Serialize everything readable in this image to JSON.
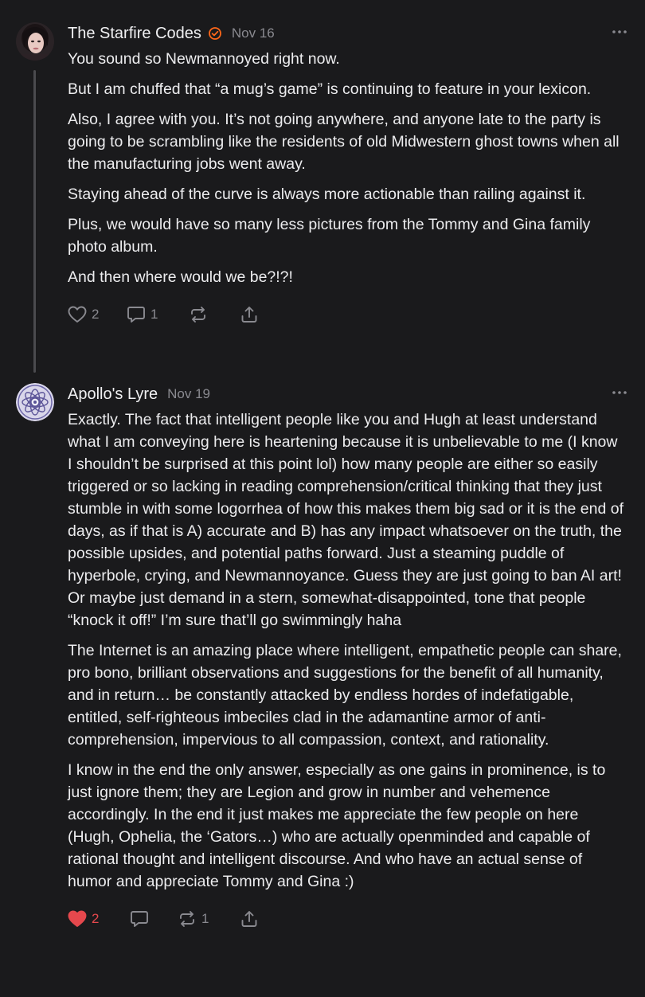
{
  "comments": [
    {
      "author": "The Starfire Codes",
      "verified_icon": "verified-check-icon",
      "date": "Nov 16",
      "paragraphs": [
        "You sound so Newmannoyed right now.",
        "But I am chuffed that “a mug’s game” is continuing to feature in your lexicon.",
        "Also, I agree with you. It’s not going anywhere, and anyone late to the party is going to be scrambling like the residents of old Midwestern ghost towns when all the manufacturing jobs went away.",
        "Staying ahead of the curve is always more actionable than railing against it.",
        "Plus, we would have so many less pictures from the Tommy and Gina family photo album.",
        "And then where would we be?!?!"
      ],
      "like_count": "2",
      "liked": false,
      "reply_count": "1",
      "restack_count": "",
      "icons": [
        "heart-icon",
        "comment-icon",
        "restack-icon",
        "share-icon",
        "more-icon"
      ]
    },
    {
      "author": "Apollo's Lyre",
      "date": "Nov 19",
      "paragraphs": [
        "Exactly. The fact that intelligent people like you and Hugh at least understand what I am conveying here is heartening because it is unbelievable to me (I know I shouldn’t be surprised at this point lol) how many people are either so easily triggered or so lacking in reading comprehension/critical thinking that they just stumble in with some logorrhea of how this makes them big sad or it is the end of days, as if that is A) accurate and B) has any impact whatsoever on the truth, the possible upsides, and potential paths forward. Just a steaming puddle of hyperbole, crying, and Newmannoyance. Guess they are just going to ban AI art! Or maybe just demand in a stern, somewhat-disappointed, tone that people “knock it off!” I’m sure that’ll go swimmingly haha",
        "The Internet is an amazing place where intelligent, empathetic people can share, pro bono, brilliant observations and suggestions for the benefit of all humanity, and in return… be constantly attacked by endless hordes of indefatigable, entitled, self-righteous imbeciles clad in the adamantine armor of anti-comprehension, impervious to all compassion, context, and rationality.",
        "I know in the end the only answer, especially as one gains in prominence, is to just ignore them; they are Legion and grow in number and vehemence accordingly. In the end it just makes me appreciate the few people on here (Hugh, Ophelia, the ‘Gators…) who are actually openminded and capable of rational thought and intelligent discourse. And who have an actual sense of humor and appreciate Tommy and Gina :)"
      ],
      "like_count": "2",
      "liked": true,
      "reply_count": "",
      "restack_count": "1",
      "icons": [
        "heart-filled-icon",
        "comment-icon",
        "restack-icon",
        "share-icon",
        "more-icon"
      ]
    }
  ],
  "colors": {
    "background": "#1a1a1c",
    "text": "#ececee",
    "muted": "#8a8a90",
    "liked": "#e5484d",
    "verified": "#ff6719",
    "thread_line": "#4a4a4e"
  }
}
